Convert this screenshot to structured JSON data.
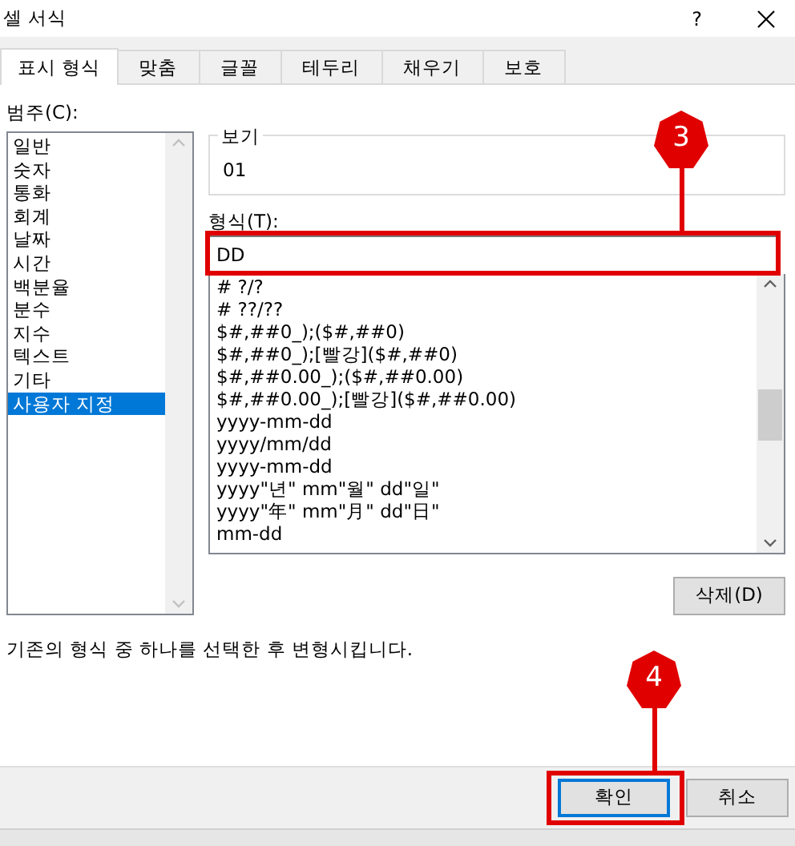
{
  "window": {
    "title": "셀 서식",
    "help": "?"
  },
  "tabs": [
    {
      "label": "표시 형식",
      "selected": true
    },
    {
      "label": "맞춤",
      "selected": false
    },
    {
      "label": "글꼴",
      "selected": false
    },
    {
      "label": "테두리",
      "selected": false
    },
    {
      "label": "채우기",
      "selected": false
    },
    {
      "label": "보호",
      "selected": false
    }
  ],
  "category_label": "범주(C):",
  "categories": [
    {
      "label": "일반",
      "selected": false
    },
    {
      "label": "숫자",
      "selected": false
    },
    {
      "label": "통화",
      "selected": false
    },
    {
      "label": "회계",
      "selected": false
    },
    {
      "label": "날짜",
      "selected": false
    },
    {
      "label": "시간",
      "selected": false
    },
    {
      "label": "백분율",
      "selected": false
    },
    {
      "label": "분수",
      "selected": false
    },
    {
      "label": "지수",
      "selected": false
    },
    {
      "label": "텍스트",
      "selected": false
    },
    {
      "label": "기타",
      "selected": false
    },
    {
      "label": "사용자 지정",
      "selected": true
    }
  ],
  "preview": {
    "label": "보기",
    "value": "01"
  },
  "format_label": "형식(T):",
  "format_field": {
    "value": "DD",
    "annotation": "3"
  },
  "formats": [
    "# ?/?",
    "# ??/??",
    "$#,##0_);($#,##0)",
    "$#,##0_);[빨강]($#,##0)",
    "$#,##0.00_);($#,##0.00)",
    "$#,##0.00_);[빨강]($#,##0.00)",
    "yyyy-mm-dd",
    "yyyy/mm/dd",
    "yyyy-mm-dd",
    "yyyy\"년\" mm\"월\" dd\"일\"",
    "yyyy\"年\" mm\"月\" dd\"日\"",
    "mm-dd"
  ],
  "delete_button": "삭제(D)",
  "description": "기존의 형식 중 하나를 선택한 후 변형시킵니다.",
  "buttons": [
    {
      "label": "확인",
      "kind": "default",
      "annotation": "4"
    },
    {
      "label": "취소",
      "kind": "normal"
    }
  ]
}
